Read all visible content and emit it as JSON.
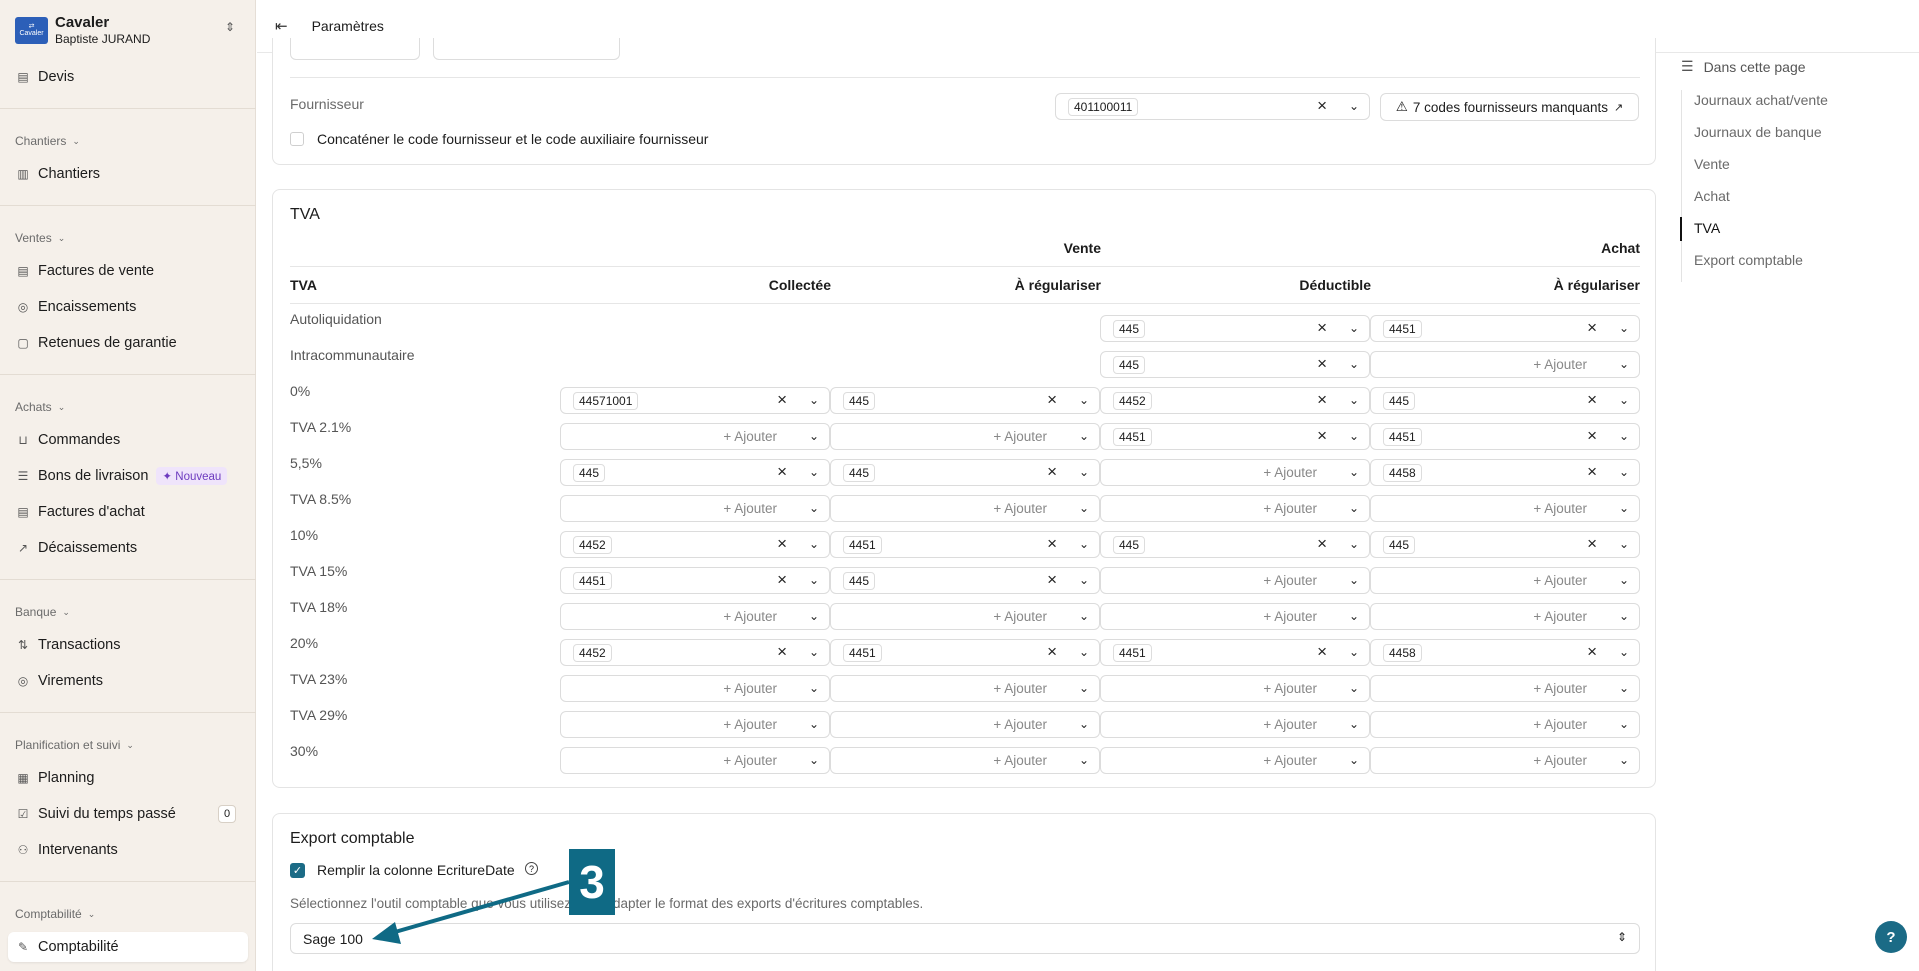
{
  "sidebar": {
    "org_name": "Cavaler",
    "user_name": "Baptiste JURAND",
    "logo_text": "Cavaler",
    "items": {
      "devis": "Devis",
      "chantiers": "Chantiers",
      "factures_vente": "Factures de vente",
      "encaissements": "Encaissements",
      "retenues": "Retenues de garantie",
      "commandes": "Commandes",
      "bons_livraison": "Bons de livraison",
      "nouveau_badge": "Nouveau",
      "factures_achat": "Factures d'achat",
      "decaissements": "Décaissements",
      "transactions": "Transactions",
      "virements": "Virements",
      "planning": "Planning",
      "suivi_temps": "Suivi du temps passé",
      "suivi_temps_count": "0",
      "intervenants": "Intervenants",
      "comptabilite": "Comptabilité"
    },
    "sections": {
      "chantiers": "Chantiers",
      "ventes": "Ventes",
      "achats": "Achats",
      "banque": "Banque",
      "planification": "Planification et suivi",
      "comptabilite": "Comptabilité"
    }
  },
  "header": {
    "title": "Paramètres"
  },
  "fournisseur": {
    "label": "Fournisseur",
    "value": "401100011",
    "missing_button": "7 codes fournisseurs manquants",
    "concat_label": "Concaténer le code fournisseur et le code auxiliaire fournisseur"
  },
  "tva": {
    "title": "TVA",
    "group_vente": "Vente",
    "group_achat": "Achat",
    "col_tva": "TVA",
    "col_collectee": "Collectée",
    "col_regul_vente": "À régulariser",
    "col_deductible": "Déductible",
    "col_regul_achat": "À régulariser",
    "add_label": "+ Ajouter",
    "rows": [
      {
        "label": "Autoliquidation",
        "cells": [
          null,
          null,
          "445",
          "4451"
        ],
        "hidden": [
          true,
          true,
          false,
          false
        ]
      },
      {
        "label": "Intracommunautaire",
        "cells": [
          null,
          null,
          "445",
          ""
        ],
        "hidden": [
          true,
          true,
          false,
          false
        ]
      },
      {
        "label": "0%",
        "cells": [
          "44571001",
          "445",
          "4452",
          "445"
        ]
      },
      {
        "label": "TVA 2.1%",
        "cells": [
          "",
          "",
          "4451",
          "4451"
        ]
      },
      {
        "label": "5,5%",
        "cells": [
          "445",
          "445",
          "",
          "4458"
        ]
      },
      {
        "label": "TVA 8.5%",
        "cells": [
          "",
          "",
          "",
          ""
        ]
      },
      {
        "label": "10%",
        "cells": [
          "4452",
          "4451",
          "445",
          "445"
        ]
      },
      {
        "label": "TVA 15%",
        "cells": [
          "4451",
          "445",
          "",
          ""
        ]
      },
      {
        "label": "TVA 18%",
        "cells": [
          "",
          "",
          "",
          ""
        ]
      },
      {
        "label": "20%",
        "cells": [
          "4452",
          "4451",
          "4451",
          "4458"
        ]
      },
      {
        "label": "TVA 23%",
        "cells": [
          "",
          "",
          "",
          ""
        ]
      },
      {
        "label": "TVA 29%",
        "cells": [
          "",
          "",
          "",
          ""
        ]
      },
      {
        "label": "30%",
        "cells": [
          "",
          "",
          "",
          ""
        ]
      }
    ]
  },
  "export": {
    "title": "Export comptable",
    "checkbox_label": "Remplir la colonne EcritureDate",
    "checkbox_checked": true,
    "description": "Sélectionnez l'outil comptable que vous utilisez pour adapter le format des exports d'écritures comptables.",
    "tool_value": "Sage 100"
  },
  "toc": {
    "heading": "Dans cette page",
    "items": [
      "Journaux achat/vente",
      "Journaux de banque",
      "Vente",
      "Achat",
      "TVA",
      "Export comptable"
    ],
    "active": "TVA"
  },
  "annotation": {
    "number": "3"
  },
  "help_label": "?",
  "colors": {
    "accent": "#0f6a85",
    "sidebar_bg": "#f5f0ea",
    "brand": "#2c5fb8"
  }
}
